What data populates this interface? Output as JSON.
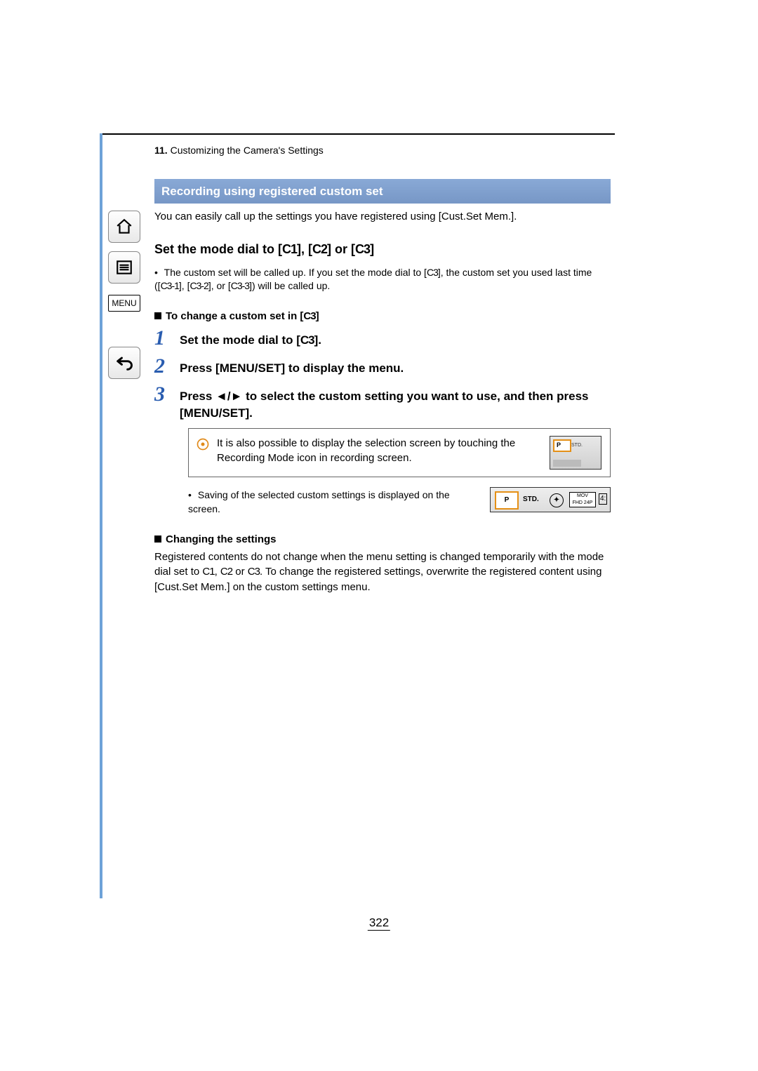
{
  "breadcrumb": {
    "number": "11.",
    "text": " Customizing the Camera's Settings"
  },
  "sidebar": {
    "menu_label": "MENU"
  },
  "banner": {
    "title": "Recording using registered custom set"
  },
  "intro": "You can easily call up the settings you have registered using [Cust.Set Mem.].",
  "subhead": {
    "prefix": "Set the mode dial to [",
    "c1": "C1",
    "mid1": "], [",
    "c2": "C2",
    "mid2": "] or [",
    "c3": "C3",
    "suffix": "]"
  },
  "note": {
    "dot": "•",
    "pre": " The custom set will be called up. If you set the mode dial to [",
    "c3": "C3",
    "mid": "], the custom set you used last time ([",
    "c31": "C3-1",
    "sep": "], [",
    "c32": "C3-2",
    "sep2": "], or [",
    "c33": "C3-3",
    "end": "]) will be called up."
  },
  "changehead": {
    "prefix": "To change a custom set in [",
    "c3": "C3",
    "suffix": "]"
  },
  "steps": {
    "s1": {
      "num": "1",
      "text_pre": "Set the mode dial to [",
      "c3": "C3",
      "text_post": "]."
    },
    "s2": {
      "num": "2",
      "text": "Press [MENU/SET] to display the menu."
    },
    "s3": {
      "num": "3",
      "text_pre": "Press ",
      "arrows": "◄/►",
      "text_post": " to select the custom setting you want to use, and then press [MENU/SET]."
    }
  },
  "tip": {
    "text": "It is also possible to display the selection screen by touching the Recording Mode icon in recording screen.",
    "thumb_p": "P",
    "thumb_std": "STD."
  },
  "saving": {
    "dot": "•",
    "text": " Saving of the selected custom settings is displayed on the screen.",
    "thumb_p": "P",
    "thumb_std": "STD.",
    "thumb_circ": "✦",
    "thumb_mov_top": "MOV",
    "thumb_mov_bot": "FHD 24P",
    "thumb_four": "4:"
  },
  "changing": {
    "head": "Changing the settings",
    "pre": "Registered contents do not change when the menu setting is changed temporarily with the mode dial set to ",
    "c1": "C1",
    "sep1": ", ",
    "c2": "C2",
    "sep2": " or ",
    "c3": "C3",
    "post": ". To change the registered settings, overwrite the registered content using [Cust.Set Mem.] on the custom settings menu."
  },
  "page_number": "322"
}
